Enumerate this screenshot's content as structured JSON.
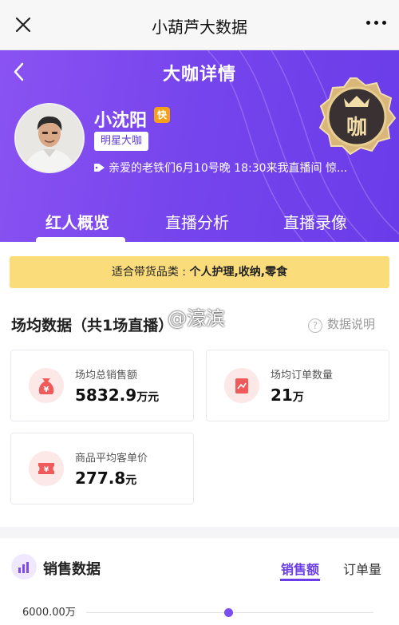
{
  "topbar": {
    "title": "小葫芦大数据"
  },
  "hero": {
    "title": "大咖详情",
    "name": "小沈阳",
    "tag": "明星大咖",
    "notice": "亲爱的老铁们6月10号晚 18:30来我直播间 惊...",
    "medal_text": "咖",
    "tabs": [
      "红人概览",
      "直播分析",
      "直播录像"
    ]
  },
  "categories": {
    "label": "适合带货品类 : ",
    "value": "个人护理,收纳,零食"
  },
  "section": {
    "title": "场均数据（共1场直播）",
    "help": "数据说明",
    "watermark": "@濠滨"
  },
  "stats": [
    {
      "label": "场均总销售额",
      "value": "5832.9",
      "unit": "万元",
      "icon": "money-bag-icon"
    },
    {
      "label": "场均订单数量",
      "value": "21",
      "unit": "万",
      "icon": "order-chart-icon"
    },
    {
      "label": "商品平均客单价",
      "value": "277.8",
      "unit": "元",
      "icon": "ticket-icon"
    }
  ],
  "sales": {
    "title": "销售数据",
    "tabs": [
      "销售额",
      "订单量"
    ],
    "y_tick": "6000.00万"
  },
  "colors": {
    "accent": "#6a3ce9",
    "banner": "#fbdc7a",
    "icon_red": "#f05a5a"
  }
}
